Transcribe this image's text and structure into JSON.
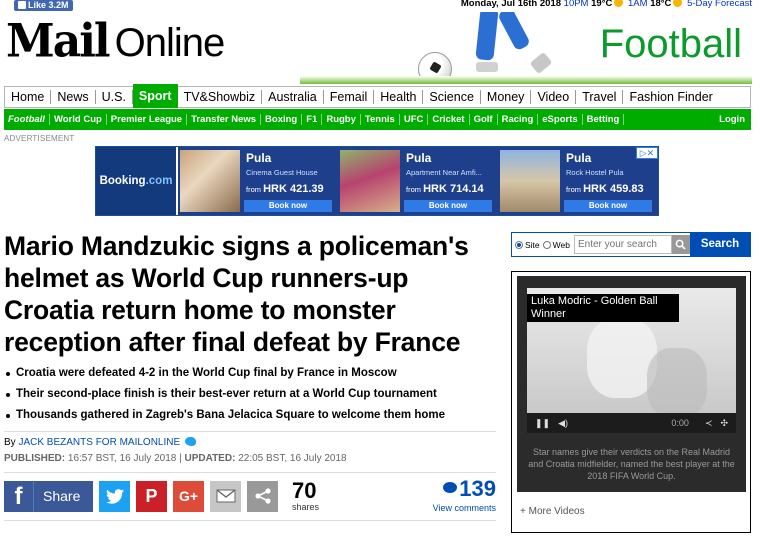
{
  "topbar": {
    "fb_like": "Like 3.2M",
    "date": "Monday, Jul 16th 2018",
    "pm_time": "10PM",
    "pm_temp": "19°C",
    "am_time": "1AM",
    "am_temp": "18°C",
    "forecast": "5-Day Forecast"
  },
  "masthead": {
    "logo_mail": "Mail",
    "logo_online": "Online",
    "channel": "Football"
  },
  "mainnav": {
    "items": [
      "Home",
      "News",
      "U.S.",
      "Sport",
      "TV&Showbiz",
      "Australia",
      "Femail",
      "Health",
      "Science",
      "Money",
      "Video",
      "Travel",
      "Fashion Finder"
    ]
  },
  "subnav": {
    "items": [
      "Football",
      "World Cup",
      "Premier League",
      "Transfer News",
      "Boxing",
      "F1",
      "Rugby",
      "Tennis",
      "UFC",
      "Cricket",
      "Golf",
      "Racing",
      "eSports",
      "Betting"
    ],
    "login": "Login"
  },
  "ad": {
    "label": "ADVERTISEMENT",
    "brand": "Booking",
    "brand_suffix": ".com",
    "choice": "▷✕",
    "cards": [
      {
        "city": "Pula",
        "name": "Cinema Guest House",
        "from": "from",
        "price": "HRK 421.39",
        "cta": "Book now"
      },
      {
        "city": "Pula",
        "name": "Apartment Near Amfi...",
        "from": "from",
        "price": "HRK 714.14",
        "cta": "Book now"
      },
      {
        "city": "Pula",
        "name": "Rock Hostel Pula",
        "from": "from",
        "price": "HRK 459.83",
        "cta": "Book now"
      }
    ]
  },
  "article": {
    "headline": "Mario Mandzukic signs a policeman's helmet as World Cup runners-up Croatia return home to monster reception after final defeat by France",
    "bullets": [
      "Croatia were defeated 4-2 in the World Cup final by France in Moscow",
      "Their second-place finish is their best-ever return at a World Cup tournament",
      "Thousands gathered in Zagreb's Bana Jelacica Square to welcome them home"
    ],
    "by": "By",
    "author": "JACK BEZANTS FOR MAILONLINE",
    "published_label": "PUBLISHED:",
    "published": "16:57 BST, 16 July 2018",
    "updated_label": "UPDATED:",
    "updated": "22:05 BST, 16 July 2018"
  },
  "share": {
    "facebook_label": "Share",
    "count": "70",
    "count_label": "shares",
    "comments": "139",
    "comments_label": "View comments"
  },
  "search": {
    "opt_site": "Site",
    "opt_web": "Web",
    "placeholder": "Enter your search",
    "button": "Search"
  },
  "video": {
    "title": "Luka Modric - Golden Ball Winner",
    "time": "0:00",
    "caption": "Star names give their verdicts on the Real Madrid and Croatia midfielder, named the best player at the 2018 FIFA World Cup.",
    "more": "+ More Videos"
  },
  "colors": {
    "sport_green": "#00ac00",
    "mail_blue": "#004db3",
    "facebook": "#3b5998",
    "twitter": "#1da1f2",
    "pinterest": "#cb2027",
    "gplus": "#dd4b39"
  }
}
